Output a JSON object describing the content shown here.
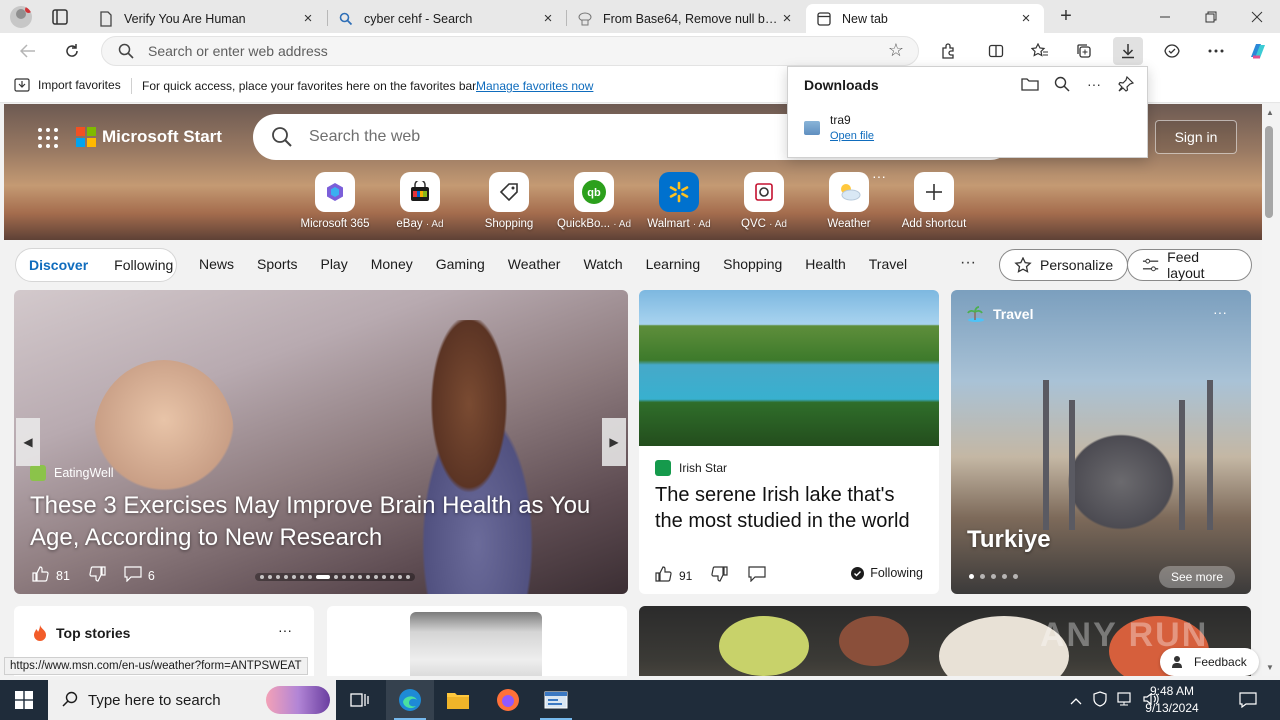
{
  "browser": {
    "tabs": [
      {
        "title": "Verify You Are Human",
        "favicon": "page-icon",
        "active": false
      },
      {
        "title": "cyber cehf - Search",
        "favicon": "search-icon",
        "active": false
      },
      {
        "title": "From Base64, Remove null bytes",
        "favicon": "chef-icon",
        "active": false
      },
      {
        "title": "New tab",
        "favicon": "newtab-icon",
        "active": true
      }
    ],
    "address_placeholder": "Search or enter web address"
  },
  "favorites_bar": {
    "import_label": "Import favorites",
    "message": "For quick access, place your favorites here on the favorites bar.",
    "manage_link": "Manage favorites now"
  },
  "downloads": {
    "title": "Downloads",
    "items": [
      {
        "name": "tra9",
        "action": "Open file"
      }
    ]
  },
  "start_page": {
    "brand": "Microsoft Start",
    "search_placeholder": "Search the web",
    "sign_in": "Sign in",
    "shortcuts": [
      {
        "label": "Microsoft 365",
        "ad": ""
      },
      {
        "label": "eBay",
        "ad": "· Ad"
      },
      {
        "label": "Shopping",
        "ad": ""
      },
      {
        "label": "QuickBo...",
        "ad": "· Ad"
      },
      {
        "label": "Walmart",
        "ad": "· Ad"
      },
      {
        "label": "QVC",
        "ad": "· Ad"
      },
      {
        "label": "Weather",
        "ad": ""
      },
      {
        "label": "Add shortcut",
        "ad": ""
      }
    ],
    "feed_tabs": [
      "Discover",
      "Following"
    ],
    "nav_links": [
      "News",
      "Sports",
      "Play",
      "Money",
      "Gaming",
      "Weather",
      "Watch",
      "Learning",
      "Shopping",
      "Health",
      "Travel"
    ],
    "personalize": "Personalize",
    "feed_layout": "Feed layout",
    "hero": {
      "source": "EatingWell",
      "headline": "These 3 Exercises May Improve Brain Health as You Age, According to New Research",
      "likes": "81",
      "comments": "6"
    },
    "lake": {
      "source": "Irish Star",
      "headline": "The serene Irish lake that's the most studied in the world",
      "likes": "91",
      "following": "Following"
    },
    "travel": {
      "category": "Travel",
      "title": "Turkiye",
      "see_more": "See more"
    },
    "top_stories": "Top stories",
    "feedback": "Feedback",
    "watermark": "ANY RUN",
    "status_url": "https://www.msn.com/en-us/weather?form=ANTPSWEAT"
  },
  "taskbar": {
    "search_placeholder": "Type here to search",
    "time": "9:48 AM",
    "date": "9/13/2024"
  },
  "colors": {
    "accent": "#0f6cbd",
    "taskbar": "#1f2c3a"
  }
}
